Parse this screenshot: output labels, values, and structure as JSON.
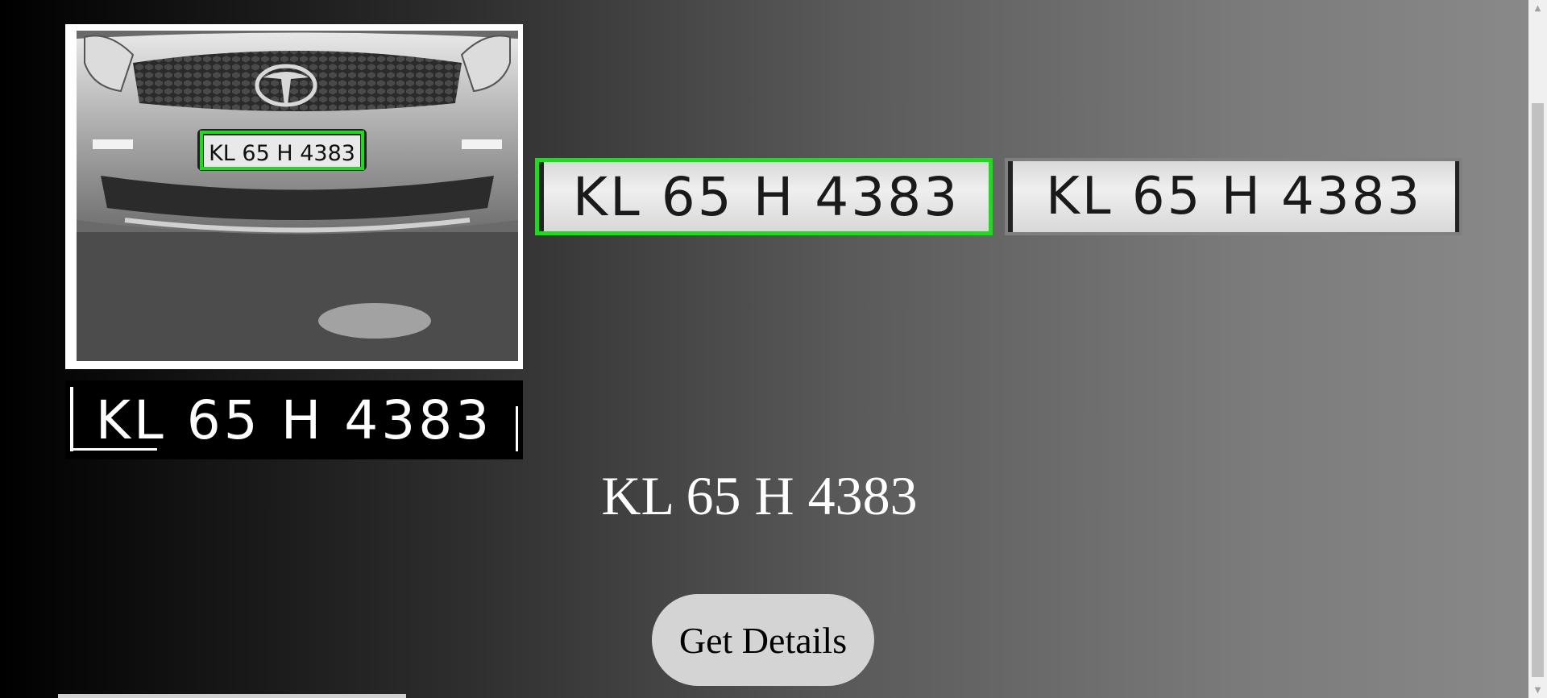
{
  "images": {
    "car_plate_text": "KL 65 H 4383",
    "detected_plate_text": "KL 65 H 4383",
    "grayscale_plate_text": "KL 65 H 4383",
    "binary_plate_text": "KL 65 H 4383"
  },
  "result": {
    "plate_number": "KL 65 H 4383"
  },
  "actions": {
    "get_details_label": "Get Details"
  },
  "scrollbar": {
    "up_arrow_icon": "chevron-up-icon",
    "down_arrow_icon": "chevron-down-icon"
  },
  "colors": {
    "detection_box": "#18e018",
    "button_bg": "#d4d4d4"
  }
}
